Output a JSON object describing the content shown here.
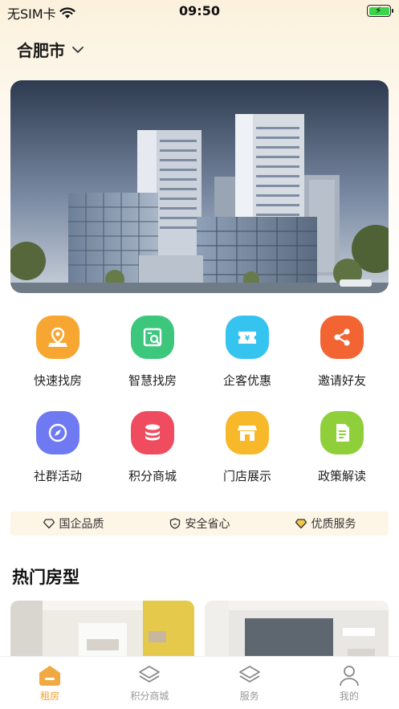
{
  "status_bar": {
    "carrier": "无SIM卡",
    "time": "09:50"
  },
  "city": {
    "name": "合肥市"
  },
  "features": [
    {
      "label": "快速找房",
      "icon": "map-pin-icon",
      "color": "#f7a731"
    },
    {
      "label": "智慧找房",
      "icon": "house-search-icon",
      "color": "#3dc77d"
    },
    {
      "label": "企客优惠",
      "icon": "coupon-icon",
      "color": "#35c3f0"
    },
    {
      "label": "邀请好友",
      "icon": "share-icon",
      "color": "#f26533"
    },
    {
      "label": "社群活动",
      "icon": "compass-icon",
      "color": "#6f7af2"
    },
    {
      "label": "积分商城",
      "icon": "database-icon",
      "color": "#f04c5f"
    },
    {
      "label": "门店展示",
      "icon": "store-icon",
      "color": "#f7b92a"
    },
    {
      "label": "政策解读",
      "icon": "document-icon",
      "color": "#8fcf3a"
    }
  ],
  "guarantees": [
    {
      "label": "国企品质",
      "icon": "diamond-icon"
    },
    {
      "label": "安全省心",
      "icon": "shield-icon"
    },
    {
      "label": "优质服务",
      "icon": "heart-diamond-icon"
    }
  ],
  "section": {
    "title": "热门房型"
  },
  "tabs": [
    {
      "label": "租房",
      "icon": "house-icon",
      "active": true
    },
    {
      "label": "积分商城",
      "icon": "layers-icon",
      "active": false
    },
    {
      "label": "服务",
      "icon": "layers-icon",
      "active": false
    },
    {
      "label": "我的",
      "icon": "person-icon",
      "active": false
    }
  ],
  "colors": {
    "accent": "#f0a030",
    "inactive_tab": "#999999"
  }
}
